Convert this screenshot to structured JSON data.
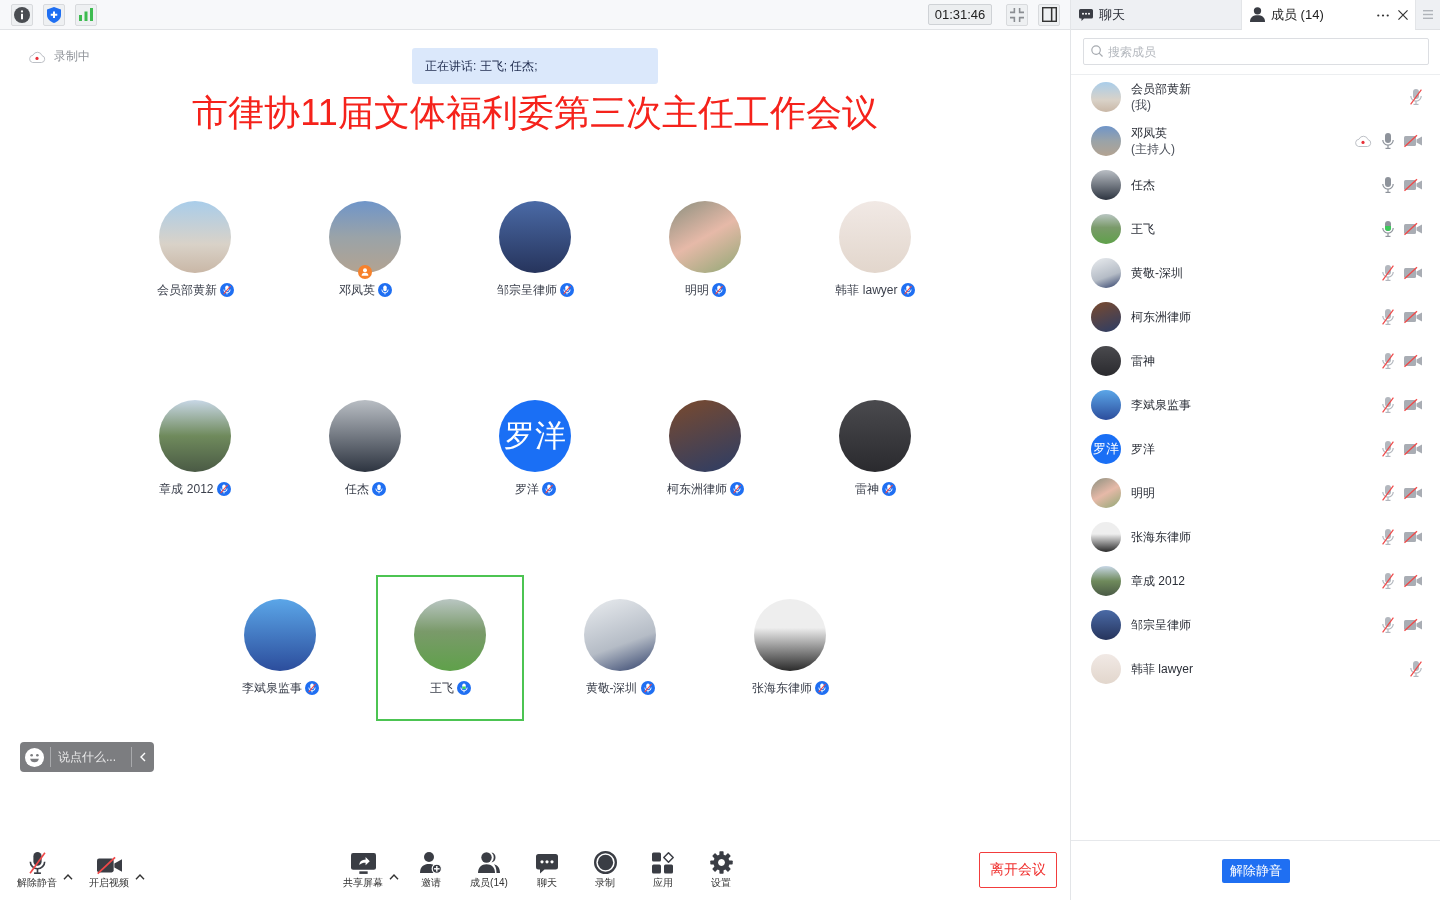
{
  "top_bar": {
    "timer": "01:31:46"
  },
  "recording": {
    "label": "录制中"
  },
  "speaking_banner": {
    "text": "正在讲话: 王飞; 任杰;"
  },
  "meeting_title": "市律协11届文体福利委第三次主任工作会议",
  "gallery": [
    {
      "name": "会员部黄新",
      "avatar": {
        "kind": "photo"
      },
      "muted": true,
      "speaking": false,
      "host": false,
      "highlighted": false
    },
    {
      "name": "邓凤英",
      "avatar": {
        "kind": "photo"
      },
      "muted": false,
      "speaking": false,
      "host": true,
      "highlighted": false
    },
    {
      "name": "邹宗呈律师",
      "avatar": {
        "kind": "photo"
      },
      "muted": true,
      "speaking": false,
      "host": false,
      "highlighted": false
    },
    {
      "name": "明明",
      "avatar": {
        "kind": "photo"
      },
      "muted": true,
      "speaking": false,
      "host": false,
      "highlighted": false
    },
    {
      "name": "韩菲 lawyer",
      "avatar": {
        "kind": "photo"
      },
      "muted": true,
      "speaking": false,
      "host": false,
      "highlighted": false
    },
    {
      "name": "章成 2012",
      "avatar": {
        "kind": "photo"
      },
      "muted": true,
      "speaking": false,
      "host": false,
      "highlighted": false
    },
    {
      "name": "任杰",
      "avatar": {
        "kind": "photo"
      },
      "muted": false,
      "speaking": false,
      "host": false,
      "highlighted": false
    },
    {
      "name": "罗洋",
      "avatar": {
        "kind": "text",
        "text": "罗洋"
      },
      "muted": true,
      "speaking": false,
      "host": false,
      "highlighted": false
    },
    {
      "name": "柯东洲律师",
      "avatar": {
        "kind": "photo"
      },
      "muted": true,
      "speaking": false,
      "host": false,
      "highlighted": false
    },
    {
      "name": "雷神",
      "avatar": {
        "kind": "photo"
      },
      "muted": true,
      "speaking": false,
      "host": false,
      "highlighted": false
    },
    {
      "name": "李斌泉监事",
      "avatar": {
        "kind": "photo"
      },
      "muted": true,
      "speaking": false,
      "host": false,
      "highlighted": false
    },
    {
      "name": "王飞",
      "avatar": {
        "kind": "photo"
      },
      "muted": false,
      "speaking": true,
      "host": false,
      "highlighted": true
    },
    {
      "name": "黄敬-深圳",
      "avatar": {
        "kind": "photo"
      },
      "muted": true,
      "speaking": false,
      "host": false,
      "highlighted": false
    },
    {
      "name": "张海东律师",
      "avatar": {
        "kind": "photo"
      },
      "muted": true,
      "speaking": false,
      "host": false,
      "highlighted": false
    }
  ],
  "chat_bar": {
    "placeholder": "说点什么..."
  },
  "toolbar": {
    "left": [
      {
        "kind": "audio",
        "label": "解除静音",
        "off": true,
        "menu": true
      },
      {
        "kind": "video",
        "label": "开启视频",
        "off": true,
        "menu": true
      }
    ],
    "center": [
      {
        "kind": "share",
        "label": "共享屏幕",
        "menu": true
      },
      {
        "kind": "invite",
        "label": "邀请",
        "menu": false
      },
      {
        "kind": "members",
        "label": "成员(14)",
        "menu": false
      },
      {
        "kind": "chat",
        "label": "聊天",
        "menu": false
      },
      {
        "kind": "record",
        "label": "录制",
        "menu": false
      },
      {
        "kind": "apps",
        "label": "应用",
        "menu": false
      },
      {
        "kind": "settings",
        "label": "设置",
        "menu": false
      }
    ],
    "leave_button": "离开会议"
  },
  "side_panel": {
    "tabs": [
      {
        "kind": "chat",
        "label": "聊天",
        "selected": false
      },
      {
        "kind": "members",
        "label": "成员 (14)",
        "selected": true
      }
    ],
    "search": {
      "placeholder": "搜索成员"
    },
    "members": [
      {
        "name": "会员部黄新",
        "role": "(我)",
        "avatar": {
          "kind": "photo"
        },
        "recording": false,
        "muted": true,
        "speaking": false
      },
      {
        "name": "邓凤英",
        "role": "(主持人)",
        "avatar": {
          "kind": "photo"
        },
        "recording": true,
        "muted": false,
        "speaking": false,
        "camera_off": true
      },
      {
        "name": "任杰",
        "avatar": {
          "kind": "photo"
        },
        "recording": false,
        "muted": false,
        "speaking": false,
        "camera_off": true
      },
      {
        "name": "王飞",
        "avatar": {
          "kind": "photo"
        },
        "recording": false,
        "muted": false,
        "speaking": true,
        "camera_off": true
      },
      {
        "name": "黄敬-深圳",
        "avatar": {
          "kind": "photo"
        },
        "recording": false,
        "muted": true,
        "speaking": false,
        "camera_off": true
      },
      {
        "name": "柯东洲律师",
        "avatar": {
          "kind": "photo"
        },
        "recording": false,
        "muted": true,
        "speaking": false,
        "camera_off": true
      },
      {
        "name": "雷神",
        "avatar": {
          "kind": "photo"
        },
        "recording": false,
        "muted": true,
        "speaking": false,
        "camera_off": true
      },
      {
        "name": "李斌泉监事",
        "avatar": {
          "kind": "photo"
        },
        "recording": false,
        "muted": true,
        "speaking": false,
        "camera_off": true
      },
      {
        "name": "罗洋",
        "avatar": {
          "kind": "text",
          "text": "罗洋"
        },
        "recording": false,
        "muted": true,
        "speaking": false,
        "camera_off": true
      },
      {
        "name": "明明",
        "avatar": {
          "kind": "photo"
        },
        "recording": false,
        "muted": true,
        "speaking": false,
        "camera_off": true
      },
      {
        "name": "张海东律师",
        "avatar": {
          "kind": "photo"
        },
        "recording": false,
        "muted": true,
        "speaking": false,
        "camera_off": true
      },
      {
        "name": "章成 2012",
        "avatar": {
          "kind": "photo"
        },
        "recording": false,
        "muted": true,
        "speaking": false,
        "camera_off": true
      },
      {
        "name": "邹宗呈律师",
        "avatar": {
          "kind": "photo"
        },
        "recording": false,
        "muted": true,
        "speaking": false,
        "camera_off": true
      },
      {
        "name": "韩菲 lawyer",
        "avatar": {
          "kind": "photo"
        },
        "recording": false,
        "muted": true,
        "speaking": false
      }
    ],
    "unmute_button": "解除静音"
  }
}
